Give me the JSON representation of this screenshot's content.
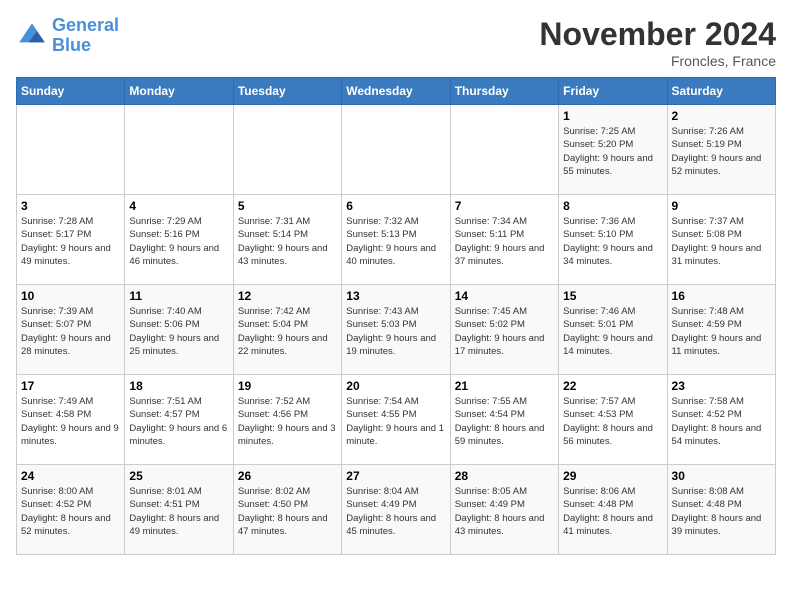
{
  "header": {
    "logo_line1": "General",
    "logo_line2": "Blue",
    "month": "November 2024",
    "location": "Froncles, France"
  },
  "days_of_week": [
    "Sunday",
    "Monday",
    "Tuesday",
    "Wednesday",
    "Thursday",
    "Friday",
    "Saturday"
  ],
  "weeks": [
    [
      {
        "day": "",
        "info": ""
      },
      {
        "day": "",
        "info": ""
      },
      {
        "day": "",
        "info": ""
      },
      {
        "day": "",
        "info": ""
      },
      {
        "day": "",
        "info": ""
      },
      {
        "day": "1",
        "info": "Sunrise: 7:25 AM\nSunset: 5:20 PM\nDaylight: 9 hours and 55 minutes."
      },
      {
        "day": "2",
        "info": "Sunrise: 7:26 AM\nSunset: 5:19 PM\nDaylight: 9 hours and 52 minutes."
      }
    ],
    [
      {
        "day": "3",
        "info": "Sunrise: 7:28 AM\nSunset: 5:17 PM\nDaylight: 9 hours and 49 minutes."
      },
      {
        "day": "4",
        "info": "Sunrise: 7:29 AM\nSunset: 5:16 PM\nDaylight: 9 hours and 46 minutes."
      },
      {
        "day": "5",
        "info": "Sunrise: 7:31 AM\nSunset: 5:14 PM\nDaylight: 9 hours and 43 minutes."
      },
      {
        "day": "6",
        "info": "Sunrise: 7:32 AM\nSunset: 5:13 PM\nDaylight: 9 hours and 40 minutes."
      },
      {
        "day": "7",
        "info": "Sunrise: 7:34 AM\nSunset: 5:11 PM\nDaylight: 9 hours and 37 minutes."
      },
      {
        "day": "8",
        "info": "Sunrise: 7:36 AM\nSunset: 5:10 PM\nDaylight: 9 hours and 34 minutes."
      },
      {
        "day": "9",
        "info": "Sunrise: 7:37 AM\nSunset: 5:08 PM\nDaylight: 9 hours and 31 minutes."
      }
    ],
    [
      {
        "day": "10",
        "info": "Sunrise: 7:39 AM\nSunset: 5:07 PM\nDaylight: 9 hours and 28 minutes."
      },
      {
        "day": "11",
        "info": "Sunrise: 7:40 AM\nSunset: 5:06 PM\nDaylight: 9 hours and 25 minutes."
      },
      {
        "day": "12",
        "info": "Sunrise: 7:42 AM\nSunset: 5:04 PM\nDaylight: 9 hours and 22 minutes."
      },
      {
        "day": "13",
        "info": "Sunrise: 7:43 AM\nSunset: 5:03 PM\nDaylight: 9 hours and 19 minutes."
      },
      {
        "day": "14",
        "info": "Sunrise: 7:45 AM\nSunset: 5:02 PM\nDaylight: 9 hours and 17 minutes."
      },
      {
        "day": "15",
        "info": "Sunrise: 7:46 AM\nSunset: 5:01 PM\nDaylight: 9 hours and 14 minutes."
      },
      {
        "day": "16",
        "info": "Sunrise: 7:48 AM\nSunset: 4:59 PM\nDaylight: 9 hours and 11 minutes."
      }
    ],
    [
      {
        "day": "17",
        "info": "Sunrise: 7:49 AM\nSunset: 4:58 PM\nDaylight: 9 hours and 9 minutes."
      },
      {
        "day": "18",
        "info": "Sunrise: 7:51 AM\nSunset: 4:57 PM\nDaylight: 9 hours and 6 minutes."
      },
      {
        "day": "19",
        "info": "Sunrise: 7:52 AM\nSunset: 4:56 PM\nDaylight: 9 hours and 3 minutes."
      },
      {
        "day": "20",
        "info": "Sunrise: 7:54 AM\nSunset: 4:55 PM\nDaylight: 9 hours and 1 minute."
      },
      {
        "day": "21",
        "info": "Sunrise: 7:55 AM\nSunset: 4:54 PM\nDaylight: 8 hours and 59 minutes."
      },
      {
        "day": "22",
        "info": "Sunrise: 7:57 AM\nSunset: 4:53 PM\nDaylight: 8 hours and 56 minutes."
      },
      {
        "day": "23",
        "info": "Sunrise: 7:58 AM\nSunset: 4:52 PM\nDaylight: 8 hours and 54 minutes."
      }
    ],
    [
      {
        "day": "24",
        "info": "Sunrise: 8:00 AM\nSunset: 4:52 PM\nDaylight: 8 hours and 52 minutes."
      },
      {
        "day": "25",
        "info": "Sunrise: 8:01 AM\nSunset: 4:51 PM\nDaylight: 8 hours and 49 minutes."
      },
      {
        "day": "26",
        "info": "Sunrise: 8:02 AM\nSunset: 4:50 PM\nDaylight: 8 hours and 47 minutes."
      },
      {
        "day": "27",
        "info": "Sunrise: 8:04 AM\nSunset: 4:49 PM\nDaylight: 8 hours and 45 minutes."
      },
      {
        "day": "28",
        "info": "Sunrise: 8:05 AM\nSunset: 4:49 PM\nDaylight: 8 hours and 43 minutes."
      },
      {
        "day": "29",
        "info": "Sunrise: 8:06 AM\nSunset: 4:48 PM\nDaylight: 8 hours and 41 minutes."
      },
      {
        "day": "30",
        "info": "Sunrise: 8:08 AM\nSunset: 4:48 PM\nDaylight: 8 hours and 39 minutes."
      }
    ]
  ]
}
